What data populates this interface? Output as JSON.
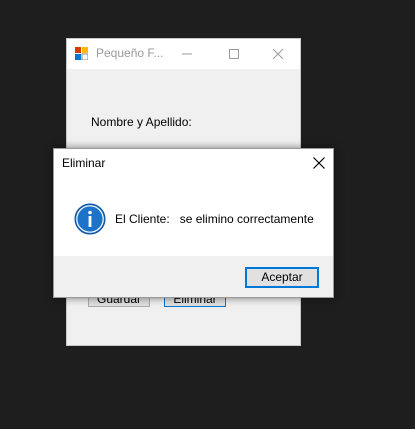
{
  "parent_window": {
    "title": "Pequeño F...",
    "label_nombre": "Nombre y Apellido:",
    "buttons": {
      "guardar": "Guardar",
      "eliminar": "Eliminar"
    },
    "icons": [
      "app-icon",
      "minimize-icon",
      "maximize-icon",
      "close-icon"
    ]
  },
  "dialog": {
    "title": "Eliminar",
    "message": "El Cliente:   se elimino correctamente",
    "ok_label": "Aceptar",
    "icon": "info-icon",
    "accent_color": "#0078d7"
  },
  "colors": {
    "desktop_bg": "#1e1e1e",
    "window_bg": "#f0f0f0",
    "button_bg": "#e1e1e1",
    "focus_border": "#0078d7"
  }
}
